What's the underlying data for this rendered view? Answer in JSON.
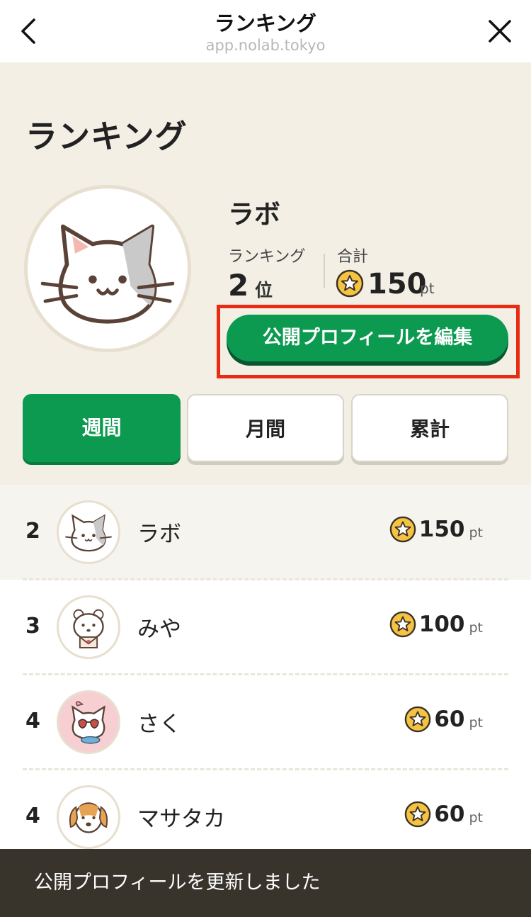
{
  "topbar": {
    "title": "ランキング",
    "url": "app.nolab.tokyo",
    "back_icon": "chevron-left-icon",
    "close_icon": "close-icon"
  },
  "header": {
    "page_title": "ランキング",
    "user_name": "ラボ",
    "rank_label": "ランキング",
    "rank_value": "2",
    "rank_unit": "位",
    "total_label": "合計",
    "total_value": "150",
    "total_unit": "pt",
    "edit_button": "公開プロフィールを編集"
  },
  "tabs": [
    {
      "label": "週間",
      "active": true
    },
    {
      "label": "月間",
      "active": false
    },
    {
      "label": "累計",
      "active": false
    }
  ],
  "ranking": [
    {
      "rank": "2",
      "name": "ラボ",
      "points": "150",
      "unit": "pt",
      "avatar": "cat-icon",
      "mine": true
    },
    {
      "rank": "3",
      "name": "みや",
      "points": "100",
      "unit": "pt",
      "avatar": "bear-icon",
      "mine": false
    },
    {
      "rank": "4",
      "name": "さく",
      "points": "60",
      "unit": "pt",
      "avatar": "cat-sunglasses-icon",
      "mine": false
    },
    {
      "rank": "4",
      "name": "マサタカ",
      "points": "60",
      "unit": "pt",
      "avatar": "dog-icon",
      "mine": false
    }
  ],
  "toast": {
    "message": "公開プロフィールを更新しました"
  },
  "colors": {
    "accent": "#0b9a4f",
    "header_bg": "#f3efe5",
    "highlight": "#ea2b14",
    "coin": "#f5c342",
    "toast_bg": "#38342c"
  }
}
